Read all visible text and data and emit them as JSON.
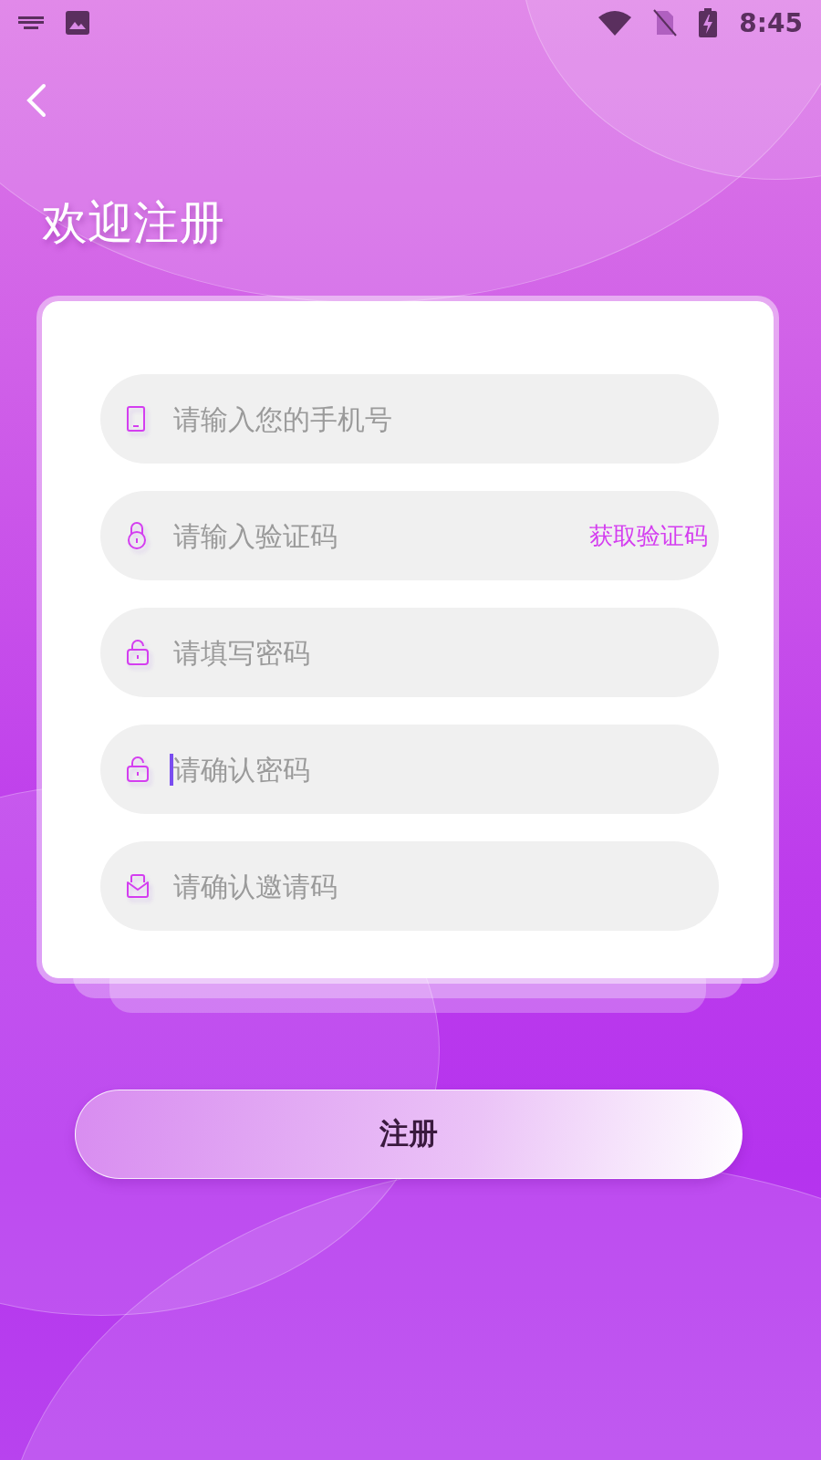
{
  "status_bar": {
    "time": "8:45"
  },
  "title": "欢迎注册",
  "fields": [
    {
      "kind": "phone",
      "placeholder": "请输入您的手机号",
      "focused": false
    },
    {
      "kind": "code",
      "placeholder": "请输入验证码",
      "focused": false,
      "action": "获取验证码"
    },
    {
      "kind": "password",
      "placeholder": "请填写密码",
      "focused": false
    },
    {
      "kind": "password",
      "placeholder": "请确认密码",
      "focused": true
    },
    {
      "kind": "invite",
      "placeholder": "请确认邀请码",
      "focused": false
    }
  ],
  "submit": "注册"
}
